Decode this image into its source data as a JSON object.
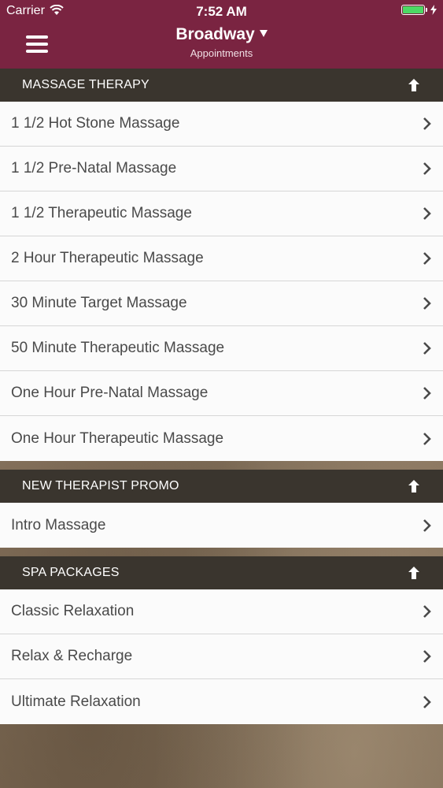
{
  "status_bar": {
    "carrier": "Carrier",
    "time": "7:52 AM",
    "battery_level": 1.0
  },
  "header": {
    "title": "Broadway",
    "subtitle": "Appointments",
    "background_color": "#7a2441"
  },
  "sections": [
    {
      "title": "MASSAGE THERAPY",
      "items": [
        "1 1/2 Hot Stone Massage",
        "1 1/2 Pre-Natal Massage",
        "1 1/2 Therapeutic Massage",
        "2 Hour Therapeutic Massage",
        "30 Minute Target Massage",
        "50 Minute Therapeutic Massage",
        "One Hour Pre-Natal Massage",
        "One Hour Therapeutic Massage"
      ]
    },
    {
      "title": "NEW THERAPIST PROMO",
      "items": [
        "Intro Massage"
      ]
    },
    {
      "title": "SPA PACKAGES",
      "items": [
        "Classic Relaxation",
        "Relax & Recharge",
        "Ultimate Relaxation"
      ]
    }
  ]
}
